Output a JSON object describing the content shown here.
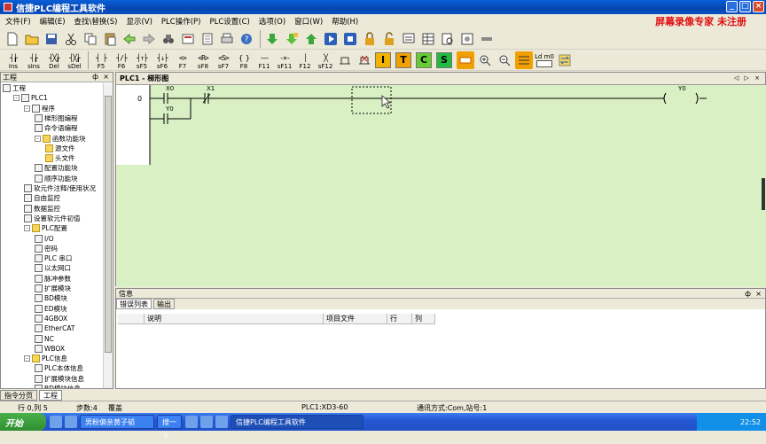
{
  "window": {
    "title": "信捷PLC编程工具软件",
    "minimize": "_",
    "maximize": "□",
    "close": "×"
  },
  "watermark": "屏幕录像专家 未注册",
  "menu": [
    "文件(F)",
    "编辑(E)",
    "查找\\替换(S)",
    "显示(V)",
    "PLC操作(P)",
    "PLC设置(C)",
    "选项(O)",
    "窗口(W)",
    "帮助(H)"
  ],
  "ladder_toolbar": [
    {
      "sym": "┤┟",
      "label": "Ins"
    },
    {
      "sym": "┤┟",
      "label": "sIns"
    },
    {
      "sym": "┤╳┟",
      "label": "Del"
    },
    {
      "sym": "┤╳┟",
      "label": "sDel"
    },
    {
      "sym": "┤ ├",
      "label": "F5"
    },
    {
      "sym": "┤/├",
      "label": "F6"
    },
    {
      "sym": "┤↑├",
      "label": "sF5"
    },
    {
      "sym": "┤↓├",
      "label": "sF6"
    },
    {
      "sym": "<>",
      "label": "F7"
    },
    {
      "sym": "<R>",
      "label": "sF8"
    },
    {
      "sym": "<S>",
      "label": "sF7"
    },
    {
      "sym": "{ }",
      "label": "F8"
    },
    {
      "sym": "——",
      "label": "F11"
    },
    {
      "sym": "-×-",
      "label": "sF11"
    },
    {
      "sym": "│",
      "label": "F12"
    },
    {
      "sym": "╳",
      "label": "sF12"
    }
  ],
  "color_buttons": [
    {
      "label": "I",
      "bg": "#f0b400"
    },
    {
      "label": "T",
      "bg": "#f0a000"
    },
    {
      "label": "C",
      "bg": "#66cc33"
    },
    {
      "label": "S",
      "bg": "#22bb44"
    }
  ],
  "ldm_label": "Ld m0",
  "project_panel": {
    "title": "工程",
    "pin": "ф",
    "close": "×",
    "tree": [
      {
        "level": 0,
        "label": "工程",
        "icon": "project",
        "toggle": ""
      },
      {
        "level": 1,
        "label": "PLC1",
        "icon": "plc",
        "toggle": "-"
      },
      {
        "level": 2,
        "label": "程序",
        "icon": "program",
        "toggle": "-"
      },
      {
        "level": 3,
        "label": "梯形图编程",
        "icon": "ladder",
        "toggle": ""
      },
      {
        "level": 3,
        "label": "命令语编程",
        "icon": "command",
        "toggle": ""
      },
      {
        "level": 3,
        "label": "函数功能块",
        "icon": "folder",
        "toggle": "-"
      },
      {
        "level": 4,
        "label": "源文件",
        "icon": "folder",
        "toggle": ""
      },
      {
        "level": 4,
        "label": "头文件",
        "icon": "folder",
        "toggle": ""
      },
      {
        "level": 3,
        "label": "配置功能块",
        "icon": "config",
        "toggle": ""
      },
      {
        "level": 3,
        "label": "顺序功能块",
        "icon": "sequence",
        "toggle": ""
      },
      {
        "level": 2,
        "label": "软元件注释/使用状况",
        "icon": "table",
        "toggle": ""
      },
      {
        "level": 2,
        "label": "自由监控",
        "icon": "table",
        "toggle": ""
      },
      {
        "level": 2,
        "label": "数据监控",
        "icon": "table",
        "toggle": ""
      },
      {
        "level": 2,
        "label": "设置软元件初值",
        "icon": "table",
        "toggle": ""
      },
      {
        "level": 2,
        "label": "PLC配置",
        "icon": "folder",
        "toggle": "-"
      },
      {
        "level": 3,
        "label": "I/O",
        "icon": "io",
        "toggle": ""
      },
      {
        "level": 3,
        "label": "密码",
        "icon": "password",
        "toggle": ""
      },
      {
        "level": 3,
        "label": "PLC 串口",
        "icon": "serial",
        "toggle": ""
      },
      {
        "level": 3,
        "label": "以太网口",
        "icon": "ethernet",
        "toggle": ""
      },
      {
        "level": 3,
        "label": "脉冲参数",
        "icon": "pulse",
        "toggle": ""
      },
      {
        "level": 3,
        "label": "扩展模块",
        "icon": "module",
        "toggle": ""
      },
      {
        "level": 3,
        "label": "BD模块",
        "icon": "bd",
        "toggle": ""
      },
      {
        "level": 3,
        "label": "ED模块",
        "icon": "ed",
        "toggle": ""
      },
      {
        "level": 3,
        "label": "4GBOX",
        "icon": "box",
        "toggle": ""
      },
      {
        "level": 3,
        "label": "EtherCAT",
        "icon": "ethercat",
        "toggle": ""
      },
      {
        "level": 3,
        "label": "NC",
        "icon": "nc",
        "toggle": ""
      },
      {
        "level": 3,
        "label": "WBOX",
        "icon": "wbox",
        "toggle": ""
      },
      {
        "level": 2,
        "label": "PLC信息",
        "icon": "folder",
        "toggle": "-"
      },
      {
        "level": 3,
        "label": "PLC本体信息",
        "icon": "info",
        "toggle": ""
      },
      {
        "level": 3,
        "label": "扩展模块信息",
        "icon": "info",
        "toggle": ""
      },
      {
        "level": 3,
        "label": "BD模块信息",
        "icon": "info",
        "toggle": ""
      }
    ],
    "tabs": [
      {
        "label": "指令分页",
        "active": false
      },
      {
        "label": "工程",
        "active": true
      }
    ]
  },
  "editor": {
    "tab_label": "PLC1 - 梯形图",
    "nav": "◁ ▷ ×",
    "rung_number": "0",
    "contacts": [
      "X0",
      "X1",
      "Y0"
    ],
    "coil": "Y0"
  },
  "info_panel": {
    "title": "信息",
    "pin": "ф",
    "close": "×",
    "tabs": [
      {
        "label": "错误列表",
        "active": true
      },
      {
        "label": "输出",
        "active": false
      }
    ],
    "columns": [
      "说明",
      "项目文件",
      "行",
      "列"
    ]
  },
  "status": {
    "position": "行 0,列 5",
    "steps": "步数:4",
    "mode": "覆盖",
    "plc": "PLC1:XD3-60",
    "comm": "通讯方式:Com,站号:1"
  },
  "taskbar": {
    "start": "开始",
    "tasks": [
      "男粉偏亲黄子韬",
      "搜一下",
      "信捷PLC编程工具软件"
    ],
    "clock": "22:52"
  }
}
